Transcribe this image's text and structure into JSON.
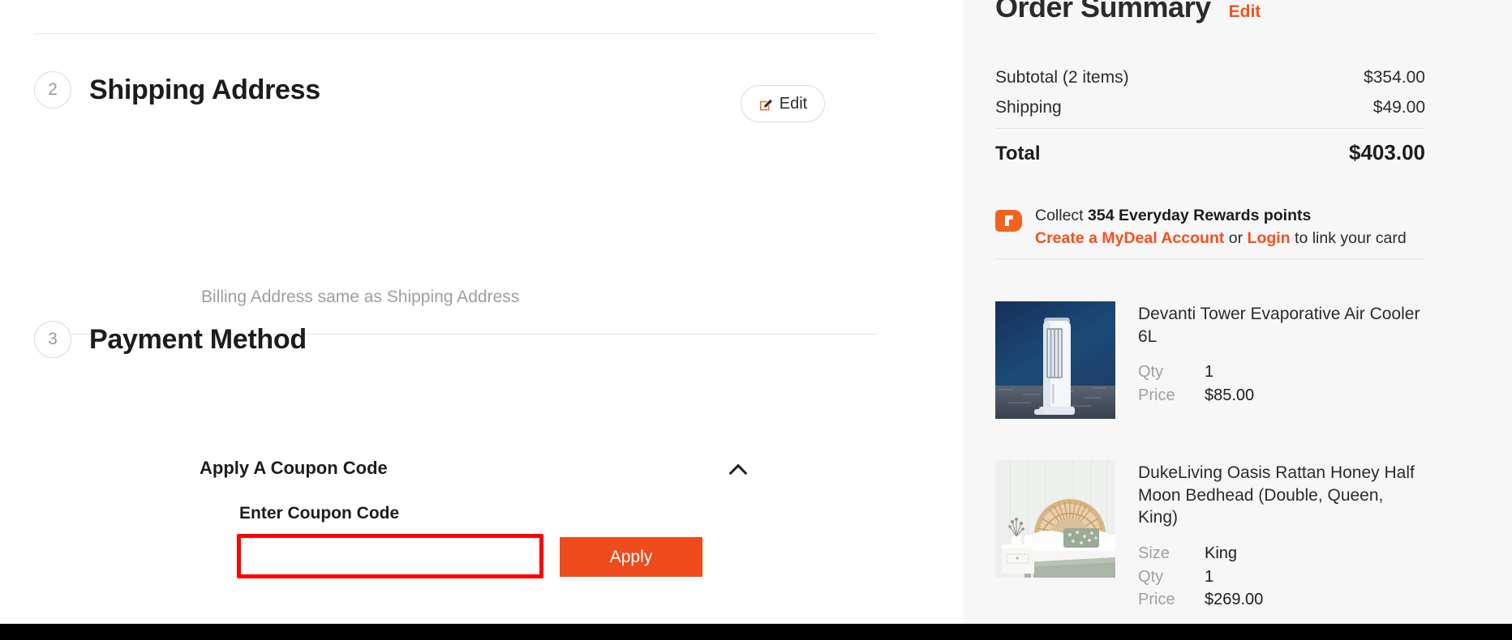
{
  "checkout": {
    "shipping_section": {
      "step": "2",
      "title": "Shipping Address",
      "edit_label": "Edit",
      "edit_icon": "pencil-square-icon",
      "billing_note": "Billing Address same as Shipping Address"
    },
    "payment_section": {
      "step": "3",
      "title": "Payment Method",
      "coupon": {
        "header": "Apply A Coupon Code",
        "collapse_icon": "chevron-up-icon",
        "field_label": "Enter Coupon Code",
        "input_value": "",
        "input_placeholder": "",
        "apply_label": "Apply"
      }
    }
  },
  "order_summary": {
    "title": "Order Summary",
    "edit_label": "Edit",
    "lines": [
      {
        "label": "Subtotal (2 items)",
        "value": "$354.00"
      },
      {
        "label": "Shipping",
        "value": "$49.00"
      }
    ],
    "total": {
      "label": "Total",
      "value": "$403.00"
    },
    "rewards": {
      "logo_icon": "everyday-rewards-icon",
      "collect_prefix": "Collect ",
      "points_bold": "354 Everyday Rewards points",
      "create_account_link": "Create a MyDeal Account",
      "or_text": " or ",
      "login_link": "Login",
      "link_suffix": " to link your card"
    },
    "products": [
      {
        "image_icon": "tower-air-cooler-photo",
        "name": "Devanti Tower Evaporative Air Cooler 6L",
        "attributes": [
          {
            "key": "Qty",
            "value": "1"
          },
          {
            "key": "Price",
            "value": "$85.00"
          }
        ]
      },
      {
        "image_icon": "rattan-bedhead-photo",
        "name": "DukeLiving Oasis Rattan Honey Half Moon Bedhead (Double, Queen, King)",
        "attributes": [
          {
            "key": "Size",
            "value": "King"
          },
          {
            "key": "Qty",
            "value": "1"
          },
          {
            "key": "Price",
            "value": "$269.00"
          }
        ]
      }
    ]
  },
  "colors": {
    "accent_orange": "#EF4B1C",
    "link_orange": "#F4511E",
    "highlight_red": "#FF0000",
    "sidebar_bg": "#F7F7F7"
  }
}
